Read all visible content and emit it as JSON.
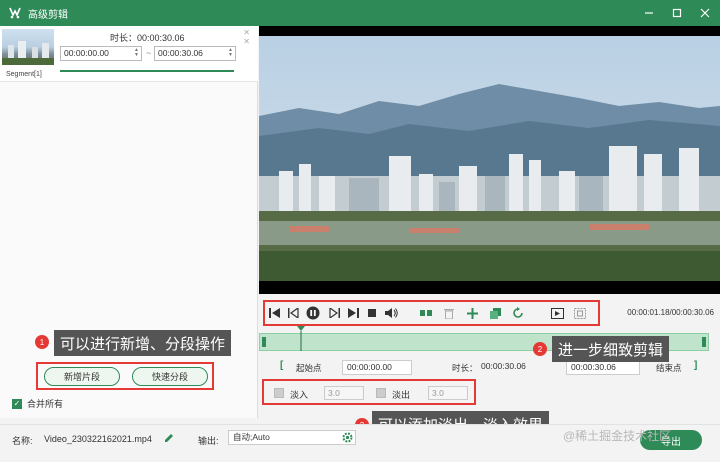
{
  "window": {
    "title": "高级剪辑"
  },
  "segment": {
    "label": "Segment[1]",
    "duration": "时长：00:00:30.06",
    "start": "00:00:00.00",
    "separator": "~",
    "end": "00:00:30.06"
  },
  "left": {
    "add_segment": "新增片段",
    "quick_split": "快速分段",
    "merge_all": "合并所有"
  },
  "player": {
    "time": "00:00:01.18/00:00:30.06"
  },
  "range": {
    "start_label": "起始点",
    "start_value": "00:00:00.00",
    "duration_label": "时长：",
    "duration_value": "00:00:30.06",
    "end_value": "00:00:30.06",
    "end_label": "结束点"
  },
  "fade": {
    "in_label": "淡入",
    "in_value": "3.0",
    "out_label": "淡出",
    "out_value": "3.0"
  },
  "annotations": {
    "a1": {
      "num": "1",
      "text": "可以进行新增、分段操作"
    },
    "a2": {
      "num": "2",
      "text": "进一步细致剪辑"
    },
    "a3": {
      "num": "3",
      "text": "可以添加淡出、淡入效果"
    }
  },
  "bottom": {
    "name_label": "名称:",
    "name_value": "Video_230322162021.mp4",
    "output_label": "输出:",
    "output_value": "自动;Auto",
    "export": "导出"
  },
  "watermark": "@稀土掘金技术社区",
  "colors": {
    "accent": "#2e8b57",
    "callout_bg": "#555555",
    "badge": "#e53935"
  }
}
